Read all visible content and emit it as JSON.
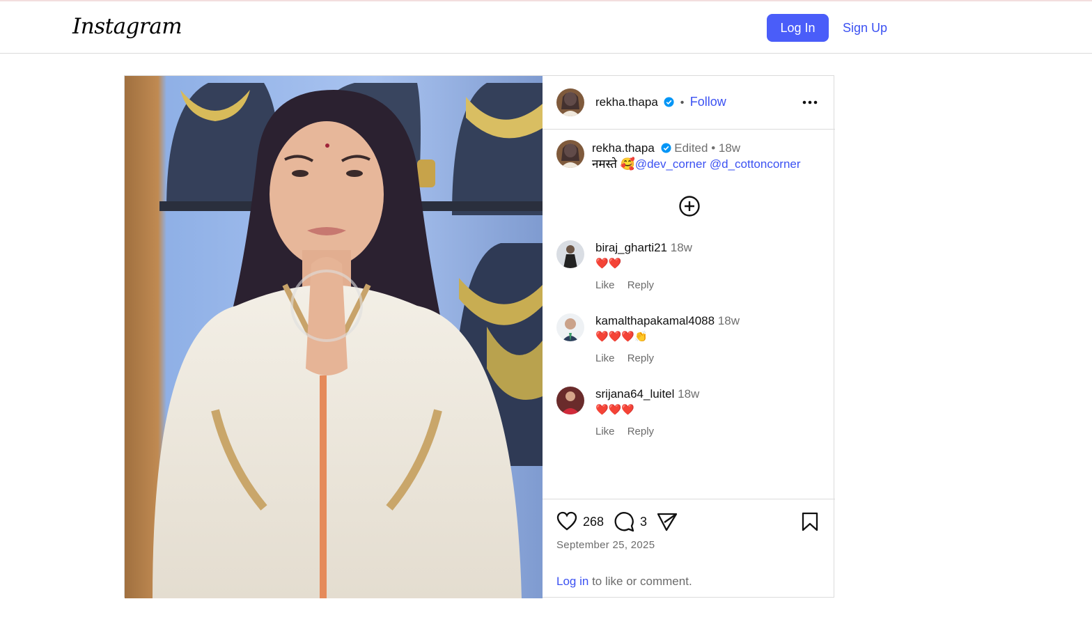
{
  "header": {
    "logo": "Instagram",
    "login_label": "Log In",
    "signup_label": "Sign Up"
  },
  "post": {
    "author": "rekha.thapa",
    "follow_label": "Follow",
    "more_label": "•••",
    "caption": {
      "author": "rekha.thapa",
      "edited": "Edited",
      "age": "18w",
      "text": "नमस्ते",
      "emoji": "🥰",
      "mentions": [
        "@dev_corner",
        "@d_cottoncorner"
      ]
    },
    "comments": [
      {
        "user": "biraj_gharti21",
        "age": "18w",
        "text": "❤️❤️",
        "like_label": "Like",
        "reply_label": "Reply"
      },
      {
        "user": "kamalthapakamal4088",
        "age": "18w",
        "text": "❤️❤️❤️👏",
        "like_label": "Like",
        "reply_label": "Reply"
      },
      {
        "user": "srijana64_luitel",
        "age": "18w",
        "text": "❤️❤️❤️",
        "like_label": "Like",
        "reply_label": "Reply"
      }
    ],
    "likes": "268",
    "comments_count": "3",
    "date": "September 25, 2025",
    "login_note": {
      "link": "Log in",
      "rest": "to like or comment."
    }
  },
  "colors": {
    "accent": "#4a5df9",
    "link": "#3b51f2",
    "border": "#dbdbdb",
    "verified": "#0095f6"
  },
  "icons": [
    "more-icon",
    "add-comment-icon",
    "heart-icon",
    "comment-icon",
    "share-icon",
    "bookmark-icon",
    "verified-icon"
  ]
}
